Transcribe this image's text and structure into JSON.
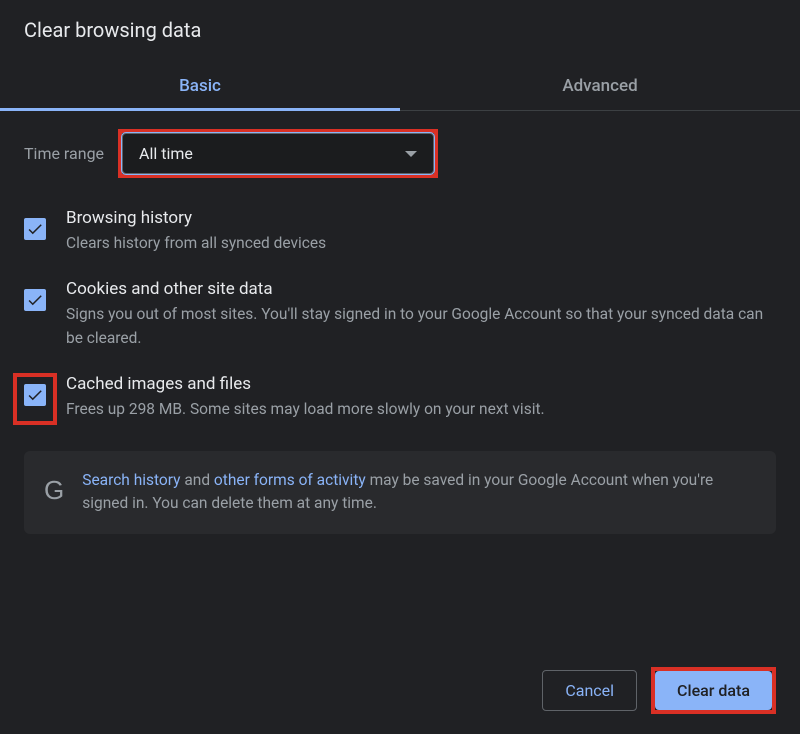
{
  "dialog": {
    "title": "Clear browsing data"
  },
  "tabs": {
    "basic": "Basic",
    "advanced": "Advanced"
  },
  "timeRange": {
    "label": "Time range",
    "value": "All time"
  },
  "options": {
    "browsingHistory": {
      "title": "Browsing history",
      "desc": "Clears history from all synced devices"
    },
    "cookies": {
      "title": "Cookies and other site data",
      "desc": "Signs you out of most sites. You'll stay signed in to your Google Account so that your synced data can be cleared."
    },
    "cache": {
      "title": "Cached images and files",
      "desc": "Frees up 298 MB. Some sites may load more slowly on your next visit."
    }
  },
  "infoBox": {
    "link1": "Search history",
    "text1": " and ",
    "link2": "other forms of activity",
    "text2": " may be saved in your Google Account when you're signed in. You can delete them at any time."
  },
  "buttons": {
    "cancel": "Cancel",
    "clear": "Clear data"
  }
}
